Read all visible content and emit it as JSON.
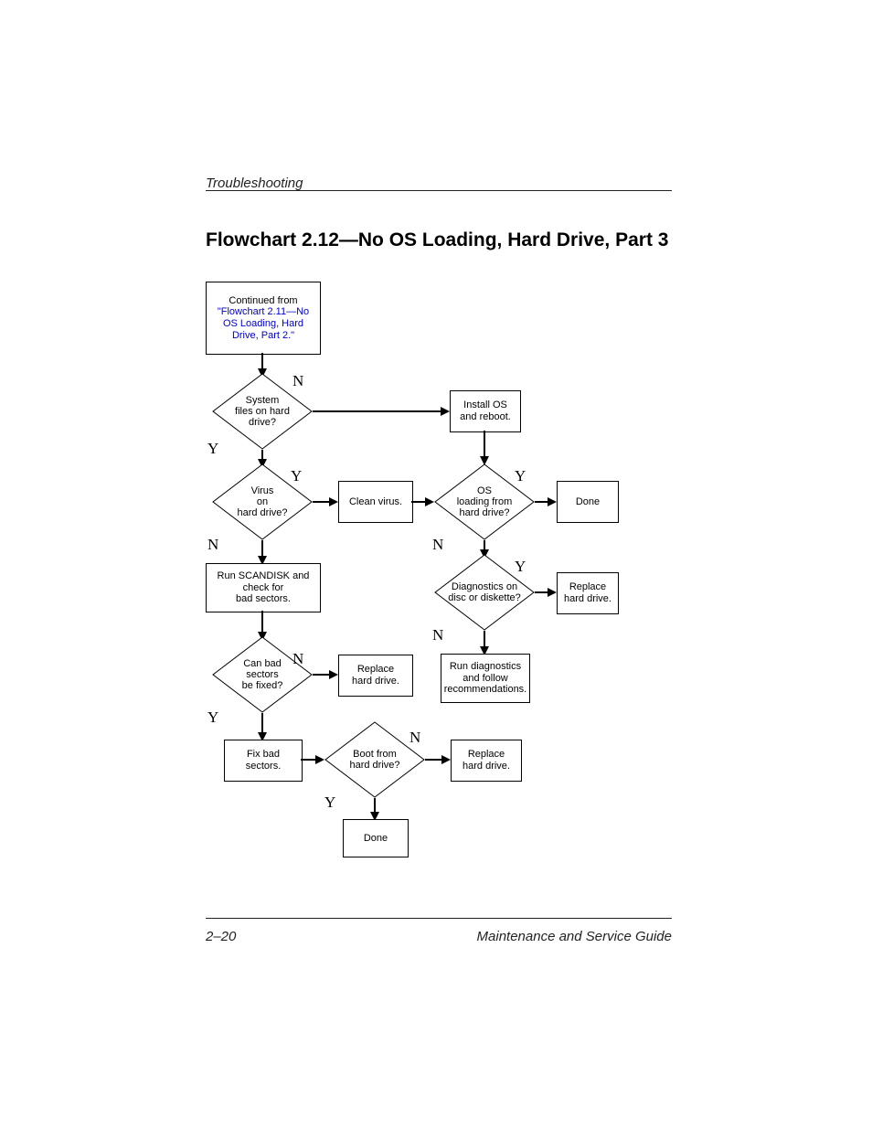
{
  "header": {
    "section": "Troubleshooting"
  },
  "title": "Flowchart 2.12—No OS Loading, Hard Drive, Part 3",
  "footer": {
    "pagenum": "2–20",
    "guide": "Maintenance and Service Guide"
  },
  "nodes": {
    "continued_label": "Continued from",
    "continued_link": "\"Flowchart 2.11—No OS Loading, Hard Drive, Part 2.\"",
    "system_files": "System\nfiles on hard\ndrive?",
    "install_os": "Install OS\nand reboot.",
    "virus": "Virus\non\nhard drive?",
    "clean_virus": "Clean virus.",
    "os_loading": "OS\nloading from\nhard drive?",
    "done1": "Done",
    "scandisk": "Run SCANDISK and\ncheck for\nbad sectors.",
    "diag_disk": "Diagnostics on\ndisc or diskette?",
    "replace_hd1": "Replace\nhard drive.",
    "can_fix": "Can bad\nsectors\nbe fixed?",
    "replace_hd2": "Replace\nhard drive.",
    "run_diag": "Run diagnostics\nand follow\nrecommendations.",
    "fix_bad": "Fix bad\nsectors.",
    "boot_from": "Boot from\nhard drive?",
    "replace_hd3": "Replace\nhard drive.",
    "done2": "Done"
  },
  "labels": {
    "Y": "Y",
    "N": "N"
  },
  "chart_data": {
    "type": "flowchart",
    "title": "Flowchart 2.12—No OS Loading, Hard Drive, Part 3",
    "nodes": [
      {
        "id": "start",
        "type": "process",
        "text": "Continued from \"Flowchart 2.11—No OS Loading, Hard Drive, Part 2.\""
      },
      {
        "id": "system_files",
        "type": "decision",
        "text": "System files on hard drive?"
      },
      {
        "id": "install_os",
        "type": "process",
        "text": "Install OS and reboot."
      },
      {
        "id": "virus",
        "type": "decision",
        "text": "Virus on hard drive?"
      },
      {
        "id": "clean_virus",
        "type": "process",
        "text": "Clean virus."
      },
      {
        "id": "os_loading",
        "type": "decision",
        "text": "OS loading from hard drive?"
      },
      {
        "id": "done1",
        "type": "terminator",
        "text": "Done"
      },
      {
        "id": "scandisk",
        "type": "process",
        "text": "Run SCANDISK and check for bad sectors."
      },
      {
        "id": "diag_disk",
        "type": "decision",
        "text": "Diagnostics on disc or diskette?"
      },
      {
        "id": "replace_hd1",
        "type": "process",
        "text": "Replace hard drive."
      },
      {
        "id": "can_fix",
        "type": "decision",
        "text": "Can bad sectors be fixed?"
      },
      {
        "id": "replace_hd2",
        "type": "process",
        "text": "Replace hard drive."
      },
      {
        "id": "run_diag",
        "type": "process",
        "text": "Run diagnostics and follow recommendations."
      },
      {
        "id": "fix_bad",
        "type": "process",
        "text": "Fix bad sectors."
      },
      {
        "id": "boot_from",
        "type": "decision",
        "text": "Boot from hard drive?"
      },
      {
        "id": "replace_hd3",
        "type": "process",
        "text": "Replace hard drive."
      },
      {
        "id": "done2",
        "type": "terminator",
        "text": "Done"
      }
    ],
    "edges": [
      {
        "from": "start",
        "to": "system_files"
      },
      {
        "from": "system_files",
        "to": "install_os",
        "label": "N"
      },
      {
        "from": "system_files",
        "to": "virus",
        "label": "Y"
      },
      {
        "from": "install_os",
        "to": "os_loading"
      },
      {
        "from": "virus",
        "to": "clean_virus",
        "label": "Y"
      },
      {
        "from": "virus",
        "to": "scandisk",
        "label": "N"
      },
      {
        "from": "clean_virus",
        "to": "os_loading"
      },
      {
        "from": "os_loading",
        "to": "done1",
        "label": "Y"
      },
      {
        "from": "os_loading",
        "to": "diag_disk",
        "label": "N"
      },
      {
        "from": "diag_disk",
        "to": "replace_hd1",
        "label": "Y"
      },
      {
        "from": "diag_disk",
        "to": "run_diag",
        "label": "N"
      },
      {
        "from": "scandisk",
        "to": "can_fix"
      },
      {
        "from": "can_fix",
        "to": "replace_hd2",
        "label": "N"
      },
      {
        "from": "can_fix",
        "to": "fix_bad",
        "label": "Y"
      },
      {
        "from": "fix_bad",
        "to": "boot_from"
      },
      {
        "from": "boot_from",
        "to": "replace_hd3",
        "label": "N"
      },
      {
        "from": "boot_from",
        "to": "done2",
        "label": "Y"
      }
    ]
  }
}
